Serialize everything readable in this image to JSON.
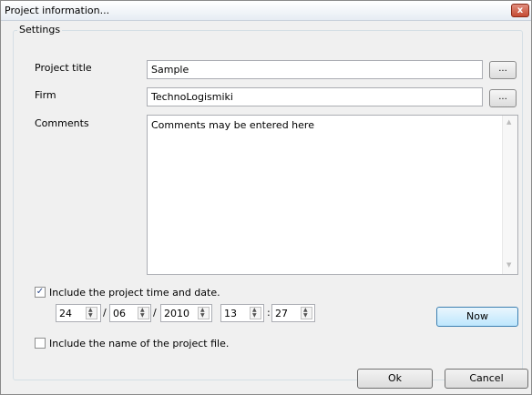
{
  "window": {
    "title": "Project information...",
    "close_glyph": "x"
  },
  "settings": {
    "legend": "Settings",
    "project_title": {
      "label": "Project title",
      "value": "Sample",
      "browse": "..."
    },
    "firm": {
      "label": "Firm",
      "value": "TechnoLogismiki",
      "browse": "..."
    },
    "comments": {
      "label": "Comments",
      "value": "Comments may be entered here"
    },
    "include_time": {
      "label": "Include the project time and date.",
      "checked": true
    },
    "datetime": {
      "day": "24",
      "month": "06",
      "year": "2010",
      "hour": "13",
      "minute": "27",
      "date_sep": "/",
      "time_sep": ":"
    },
    "now_button": "Now",
    "include_file": {
      "label": "Include the name of the project file.",
      "checked": false
    }
  },
  "footer": {
    "ok": "Ok",
    "cancel": "Cancel"
  },
  "icons": {
    "close": "close-icon",
    "check": "check-icon",
    "spin_up": "arrow-up-icon",
    "spin_down": "arrow-down-icon",
    "scroll_up": "scroll-up-icon",
    "scroll_down": "scroll-down-icon"
  }
}
